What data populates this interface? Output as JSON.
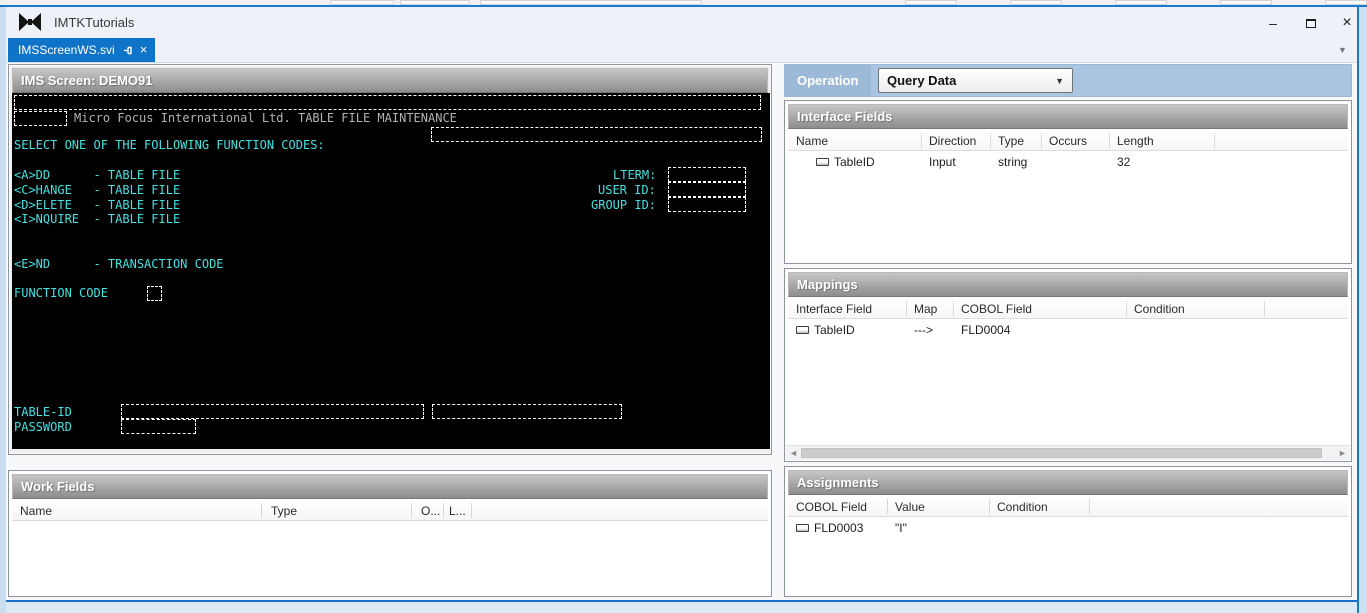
{
  "window": {
    "title": "IMTKTutorials"
  },
  "tab": {
    "label": "IMSScreenWS.svi"
  },
  "icons": {
    "minimize": "–",
    "close": "×",
    "tab_close": "×",
    "tab_menu_arrow": "▼",
    "dropdown_arrow": "▼",
    "scroll_left": "◄",
    "scroll_right": "►"
  },
  "colors": {
    "terminal_text": "#45e0e0",
    "terminal_banner": "#b2b2b2",
    "tab_blue": "#0f74c8",
    "window_border_blue": "#1a79cc",
    "caption_gray": "#8d8d8d",
    "operation_bar_blue": "#aac5e1"
  },
  "ims_screen": {
    "caption": "IMS Screen: DEMO91",
    "terminal": {
      "banner": "Micro Focus International Ltd. TABLE FILE MAINTENANCE",
      "select_prompt": "SELECT ONE OF THE FOLLOWING FUNCTION CODES:",
      "option_add": "<A>DD      - TABLE FILE",
      "option_change": "<C>HANGE   - TABLE FILE",
      "option_delete": "<D>ELETE   - TABLE FILE",
      "option_inquire": "<I>NQUIRE  - TABLE FILE",
      "option_end": "<E>ND      - TRANSACTION CODE",
      "function_code_label": "FUNCTION CODE",
      "table_id_label": "TABLE-ID",
      "password_label": "PASSWORD",
      "lterm_label": "LTERM:",
      "user_id_label": "USER ID:",
      "group_id_label": "GROUP ID:"
    }
  },
  "operation": {
    "label": "Operation",
    "selected": "Query Data"
  },
  "interface_fields": {
    "caption": "Interface Fields",
    "columns": [
      "Name",
      "Direction",
      "Type",
      "Occurs",
      "Length"
    ],
    "rows": [
      {
        "name": "TableID",
        "direction": "Input",
        "type": "string",
        "occurs": "",
        "length": "32"
      }
    ]
  },
  "mappings": {
    "caption": "Mappings",
    "columns": [
      "Interface Field",
      "Map",
      "COBOL Field",
      "Condition"
    ],
    "rows": [
      {
        "interface_field": "TableID",
        "map": "--->",
        "cobol_field": "FLD0004",
        "condition": ""
      }
    ]
  },
  "work_fields": {
    "caption": "Work Fields",
    "columns": [
      "Name",
      "Type",
      "O...",
      "L..."
    ]
  },
  "assignments": {
    "caption": "Assignments",
    "columns": [
      "COBOL Field",
      "Value",
      "Condition"
    ],
    "rows": [
      {
        "cobol_field": "FLD0003",
        "value": "\"I\"",
        "condition": ""
      }
    ]
  }
}
